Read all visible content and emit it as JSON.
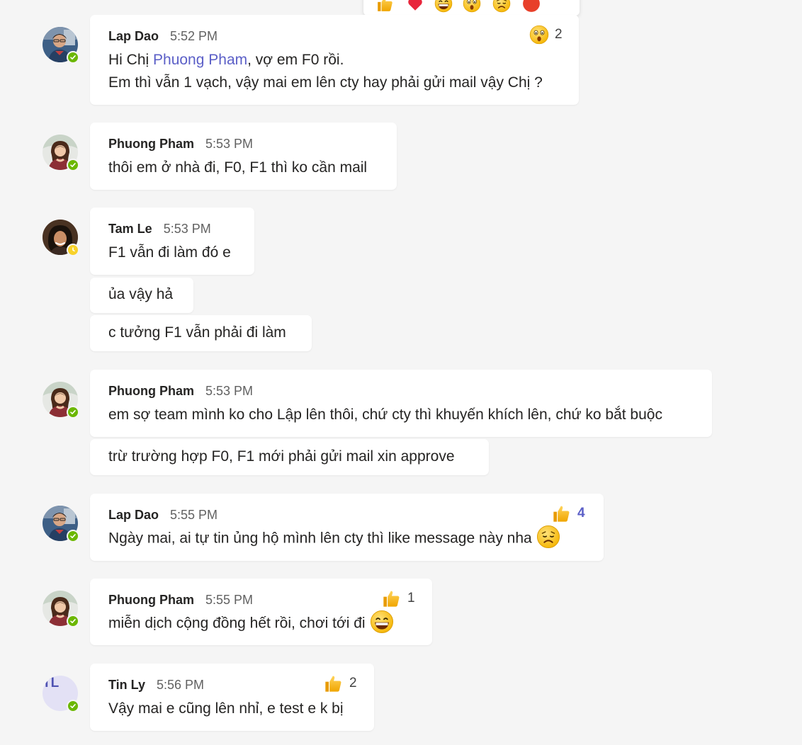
{
  "reaction_toolbar": {
    "items": [
      "like",
      "heart",
      "laugh",
      "surprised",
      "sad",
      "angry"
    ]
  },
  "messages": [
    {
      "author": "Lap Dao",
      "time": "5:52 PM",
      "status": "available",
      "line1_prefix": "Hi Chị ",
      "mention": "Phuong Pham",
      "line1_suffix": ", vợ em F0 rồi.",
      "line2": "Em thì vẫn 1 vạch, vậy mai em lên cty hay phải gửi mail vậy Chị ?",
      "reaction": {
        "icon": "surprised-icon",
        "count": "2"
      }
    },
    {
      "author": "Phuong Pham",
      "time": "5:53 PM",
      "status": "available",
      "text": "thôi em ở nhà đi, F0, F1 thì ko cần mail"
    },
    {
      "author": "Tam Le",
      "time": "5:53 PM",
      "status": "away",
      "text": "F1 vẫn đi làm đó e",
      "followups": [
        "ủa vậy hả",
        "c tưởng F1 vẫn phải đi làm"
      ]
    },
    {
      "author": "Phuong Pham",
      "time": "5:53 PM",
      "status": "available",
      "text": "em sợ team mình ko cho Lập lên thôi, chứ cty thì khuyến khích lên, chứ ko bắt buộc",
      "followups": [
        "trừ trường hợp F0, F1 mới phải gửi mail xin approve"
      ]
    },
    {
      "author": "Lap Dao",
      "time": "5:55 PM",
      "status": "available",
      "text": "Ngày mai, ai tự tin ủng hộ mình lên cty thì like message này nha",
      "reaction": {
        "icon": "like-icon",
        "count": "4"
      }
    },
    {
      "author": "Phuong Pham",
      "time": "5:55 PM",
      "status": "available",
      "text": "miễn dịch cộng đồng hết rồi, chơi tới đi",
      "reaction": {
        "icon": "like-icon",
        "count": "1"
      }
    },
    {
      "author": "Tin Ly",
      "time": "5:56 PM",
      "status": "available",
      "initials": "TL",
      "text": "Vậy mai e cũng lên nhỉ, e test e k bị",
      "reaction": {
        "icon": "like-icon",
        "count": "2"
      }
    }
  ]
}
